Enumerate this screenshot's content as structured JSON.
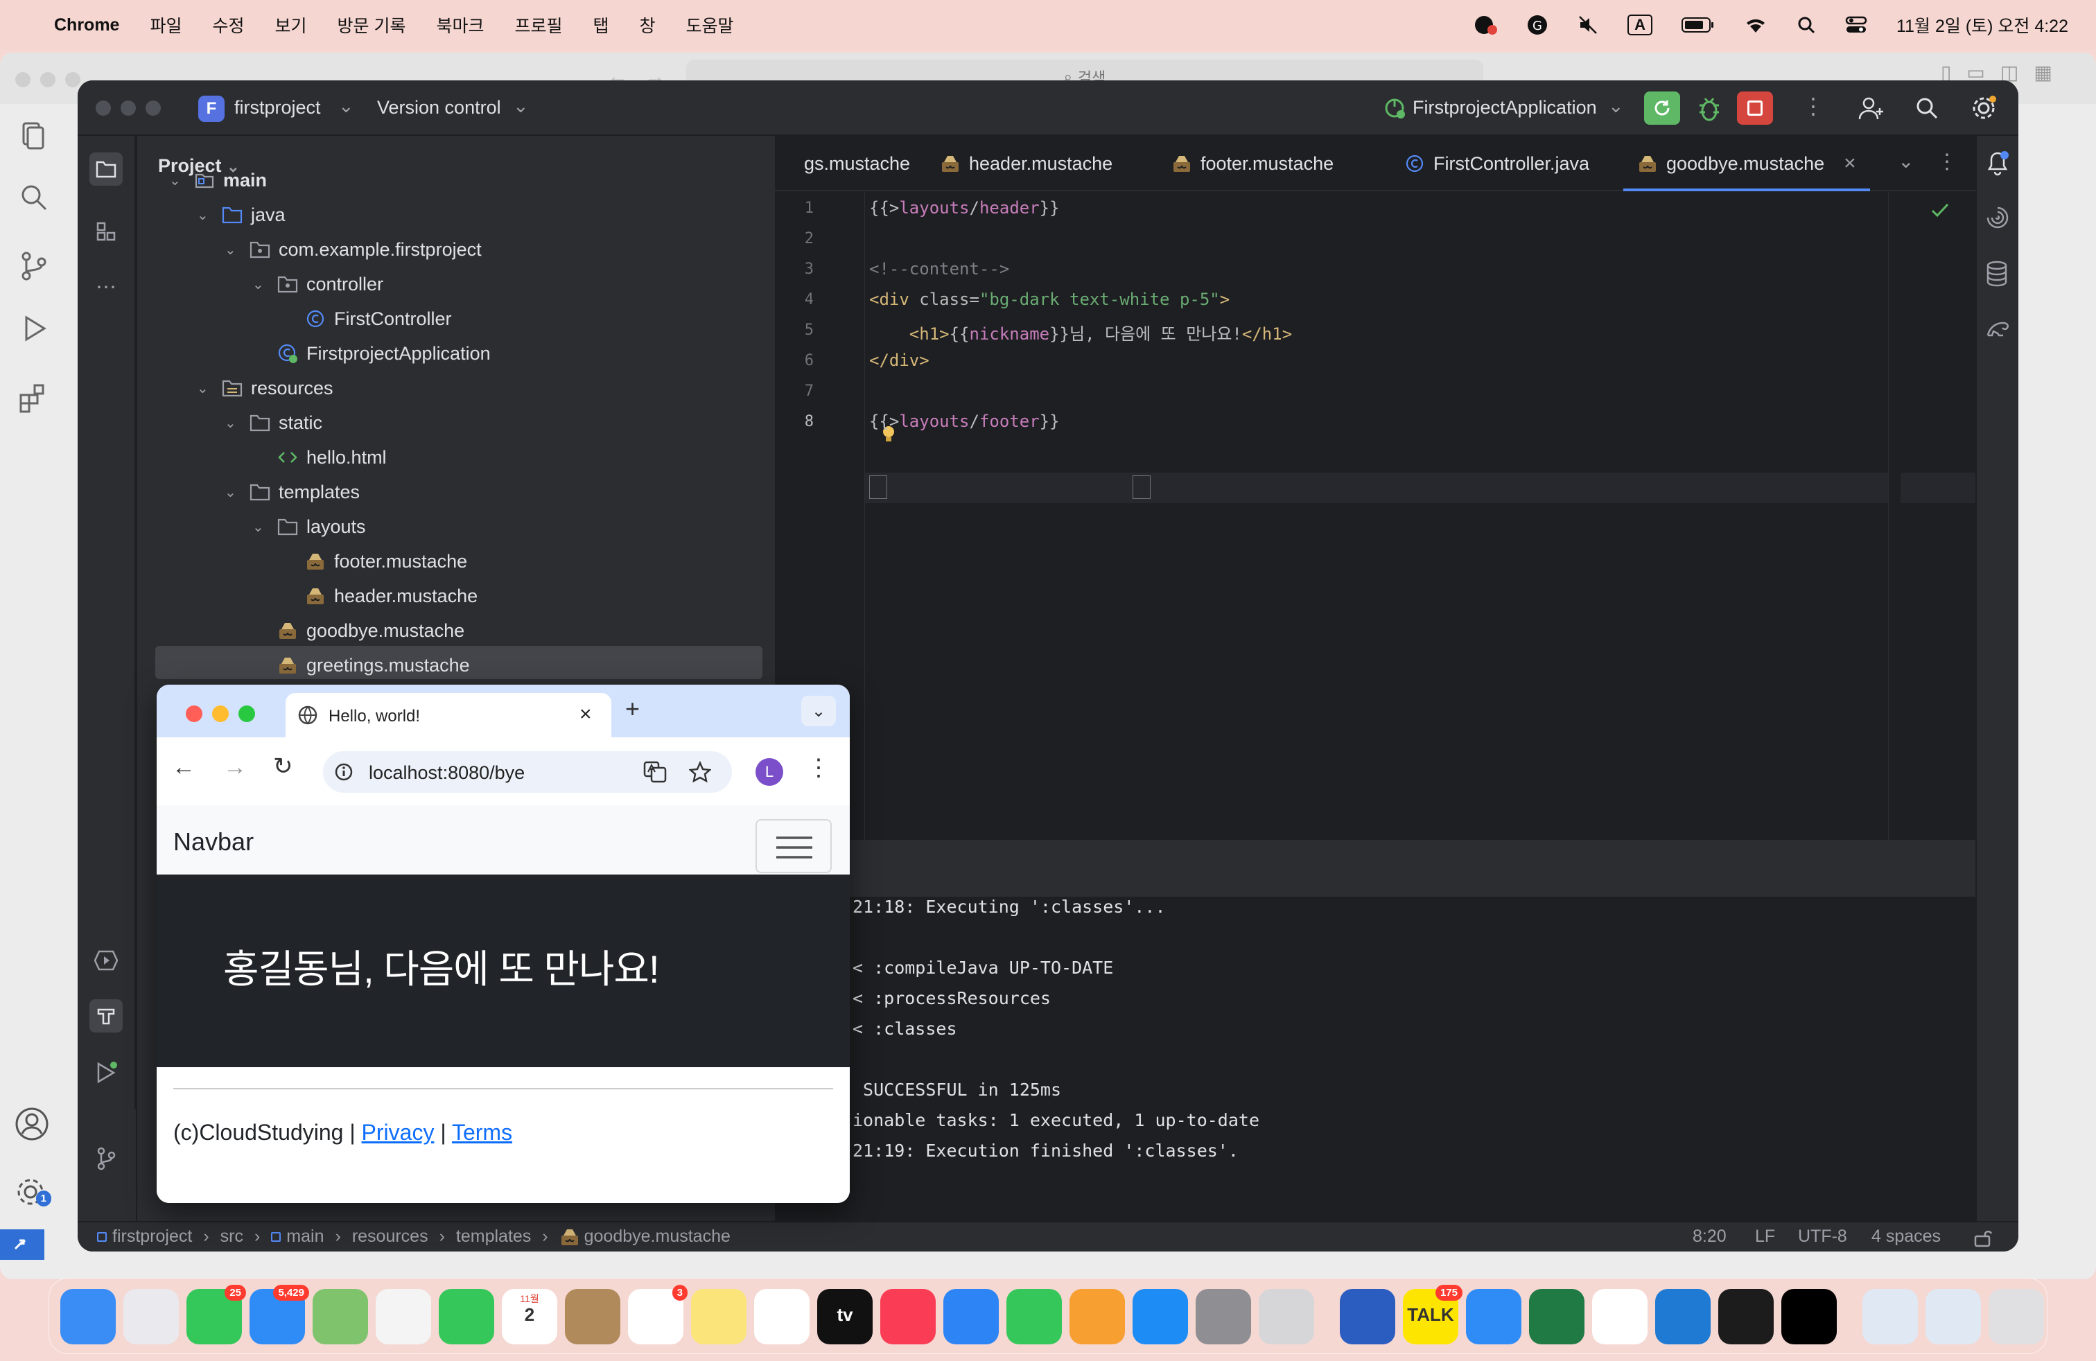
{
  "menubar": {
    "app": "Chrome",
    "items": [
      "파일",
      "수정",
      "보기",
      "방문 기록",
      "북마크",
      "프로필",
      "탭",
      "창",
      "도움말"
    ],
    "clock": "11월 2일 (토) 오전 4:22",
    "input_indicator": "A"
  },
  "bg_chrome": {
    "search_placeholder": "검색"
  },
  "ide": {
    "project_letter": "F",
    "project_name": "firstproject",
    "vcs_label": "Version control",
    "run_config": "FirstprojectApplication",
    "project_panel_title": "Project",
    "tree": [
      {
        "label": "main",
        "kind": "module",
        "depth": 2,
        "open": true,
        "bold": true
      },
      {
        "label": "java",
        "kind": "folder-src",
        "depth": 3,
        "open": true
      },
      {
        "label": "com.example.firstproject",
        "kind": "package",
        "depth": 4,
        "open": true
      },
      {
        "label": "controller",
        "kind": "package",
        "depth": 5,
        "open": true
      },
      {
        "label": "FirstController",
        "kind": "class",
        "depth": 6
      },
      {
        "label": "FirstprojectApplication",
        "kind": "spring-class",
        "depth": 5
      },
      {
        "label": "resources",
        "kind": "folder-res",
        "depth": 3,
        "open": true
      },
      {
        "label": "static",
        "kind": "folder",
        "depth": 4,
        "open": true
      },
      {
        "label": "hello.html",
        "kind": "html",
        "depth": 5
      },
      {
        "label": "templates",
        "kind": "folder",
        "depth": 4,
        "open": true
      },
      {
        "label": "layouts",
        "kind": "folder",
        "depth": 5,
        "open": true
      },
      {
        "label": "footer.mustache",
        "kind": "mustache",
        "depth": 6
      },
      {
        "label": "header.mustache",
        "kind": "mustache",
        "depth": 6
      },
      {
        "label": "goodbye.mustache",
        "kind": "mustache",
        "depth": 5,
        "selected": true
      },
      {
        "label": "greetings.mustache",
        "kind": "mustache",
        "depth": 5
      }
    ],
    "tabs": [
      {
        "label": "gs.mustache",
        "kind": "mustache-cut"
      },
      {
        "label": "header.mustache",
        "kind": "mustache"
      },
      {
        "label": "footer.mustache",
        "kind": "mustache"
      },
      {
        "label": "FirstController.java",
        "kind": "class"
      },
      {
        "label": "goodbye.mustache",
        "kind": "mustache",
        "active": true
      }
    ],
    "code_lines": [
      {
        "n": "1",
        "parts": [
          [
            "{{>",
            "#bcbec4"
          ],
          [
            "layouts",
            "#c77dbb"
          ],
          [
            "/",
            "#bcbec4"
          ],
          [
            "header",
            "#c77dbb"
          ],
          [
            "}}",
            "#bcbec4"
          ]
        ]
      },
      {
        "n": "2",
        "parts": []
      },
      {
        "n": "3",
        "parts": [
          [
            "<!--content-->",
            "#7a7e85"
          ]
        ]
      },
      {
        "n": "4",
        "parts": [
          [
            "<div ",
            "#d5b778"
          ],
          [
            "class",
            "#bababa"
          ],
          [
            "=",
            "#bcbec4"
          ],
          [
            "\"bg-dark text-white p-5\"",
            "#6aab73"
          ],
          [
            ">",
            "#d5b778"
          ]
        ]
      },
      {
        "n": "5",
        "parts": [
          [
            "    ",
            "#bcbec4"
          ],
          [
            "<h1>",
            "#d5b778"
          ],
          [
            "{{",
            "#bcbec4"
          ],
          [
            "nickname",
            "#c77dbb"
          ],
          [
            "}}님, 다음에 또 만나요!",
            "#bcbec4"
          ],
          [
            "</h1>",
            "#d5b778"
          ]
        ]
      },
      {
        "n": "6",
        "parts": [
          [
            "</div>",
            "#d5b778"
          ]
        ]
      },
      {
        "n": "7",
        "parts": []
      },
      {
        "n": "8",
        "parts": [
          [
            "{{>",
            "#bcbec4"
          ],
          [
            "layouts",
            "#c77dbb"
          ],
          [
            "/",
            "#bcbec4"
          ],
          [
            "footer",
            "#c77dbb"
          ],
          [
            "}}",
            "#bcbec4"
          ]
        ]
      }
    ],
    "console_lines": [
      "21:18: Executing ':classes'...",
      "",
      "< :compileJava UP-TO-DATE",
      "< :processResources",
      "< :classes",
      "",
      " SUCCESSFUL in 125ms",
      "ionable tasks: 1 executed, 1 up-to-date",
      "21:19: Execution finished ':classes'."
    ],
    "breadcrumb": [
      "firstproject",
      "src",
      "main",
      "resources",
      "templates",
      "goodbye.mustache"
    ],
    "status": {
      "position": "8:20",
      "line_sep": "LF",
      "encoding": "UTF-8",
      "indent": "4 spaces"
    },
    "settings_badge": "1"
  },
  "browser": {
    "tab_title": "Hello, world!",
    "url": "localhost:8080/bye",
    "profile_initial": "L",
    "navbar_brand": "Navbar",
    "heading": "홍길동님, 다음에 또 만나요!",
    "footer_prefix": "(c)CloudStudying | ",
    "footer_privacy": "Privacy",
    "footer_sep": " | ",
    "footer_terms": "Terms"
  },
  "dock": [
    {
      "name": "finder",
      "color": "#3a8df5"
    },
    {
      "name": "launchpad",
      "color": "#e9e9ee"
    },
    {
      "name": "messages",
      "color": "#34c759",
      "badge": "25"
    },
    {
      "name": "mail",
      "color": "#2f8cf7",
      "badge": "5,429"
    },
    {
      "name": "maps",
      "color": "#7fc36d"
    },
    {
      "name": "photos",
      "color": "#f4f4f4"
    },
    {
      "name": "facetime",
      "color": "#35c759"
    },
    {
      "name": "calendar",
      "color": "#ffffff",
      "text": "2",
      "month": "11월"
    },
    {
      "name": "contacts",
      "color": "#b08a5b"
    },
    {
      "name": "reminders",
      "color": "#ffffff",
      "badge": "3"
    },
    {
      "name": "notes",
      "color": "#fbe47a"
    },
    {
      "name": "freeform",
      "color": "#ffffff"
    },
    {
      "name": "apple-tv",
      "color": "#111111",
      "text": "tv"
    },
    {
      "name": "music",
      "color": "#fa3c55"
    },
    {
      "name": "keynote",
      "color": "#2c84f5"
    },
    {
      "name": "numbers",
      "color": "#35c759"
    },
    {
      "name": "pages",
      "color": "#f7a031"
    },
    {
      "name": "app-store",
      "color": "#1d8cf5"
    },
    {
      "name": "system-settings",
      "color": "#8e8e93"
    },
    {
      "name": "iphone-mirroring",
      "color": "#d6d6d8"
    },
    {
      "name": "word",
      "color": "#2b5cbf"
    },
    {
      "name": "kakaotalk",
      "color": "#fee500",
      "text": "TALK",
      "badge": "175"
    },
    {
      "name": "safari",
      "color": "#2f8cf7"
    },
    {
      "name": "excel",
      "color": "#1f7a44"
    },
    {
      "name": "chrome",
      "color": "#ffffff"
    },
    {
      "name": "vscode",
      "color": "#1e7ad3"
    },
    {
      "name": "terminal",
      "color": "#1c1c1c"
    },
    {
      "name": "intellij",
      "color": "#000000"
    },
    {
      "name": "folder-stack",
      "color": "#dfe8f3"
    },
    {
      "name": "downloads-stack",
      "color": "#dfe8f3"
    },
    {
      "name": "trash",
      "color": "#e0e0e2"
    }
  ]
}
